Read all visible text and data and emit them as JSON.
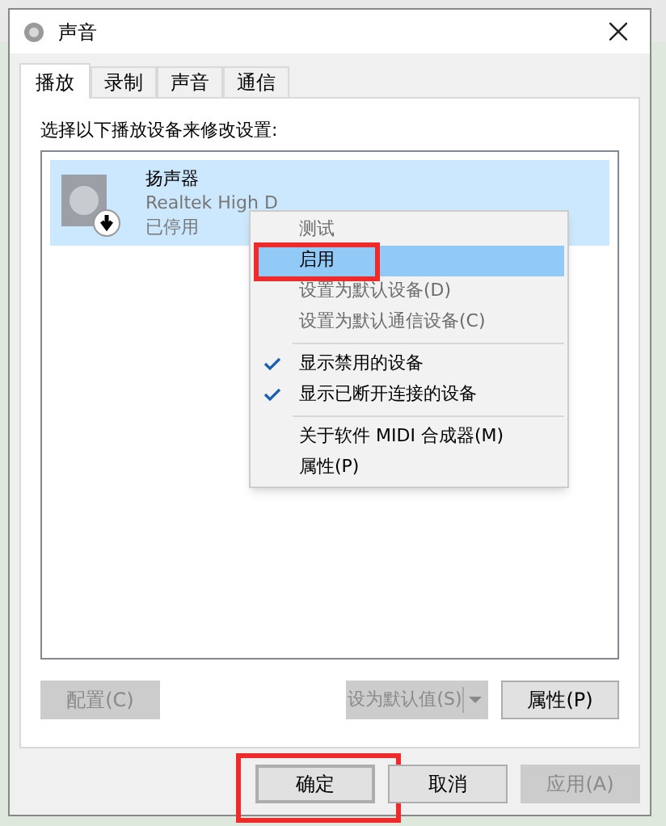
{
  "window": {
    "title": "声音"
  },
  "tabs": [
    {
      "label": "播放",
      "selected": true
    },
    {
      "label": "录制",
      "selected": false
    },
    {
      "label": "声音",
      "selected": false
    },
    {
      "label": "通信",
      "selected": false
    }
  ],
  "instruction": "选择以下播放设备来修改设置:",
  "devices": [
    {
      "name": "扬声器",
      "driver": "Realtek High D",
      "status": "已停用",
      "selected": true,
      "disabled": true
    }
  ],
  "context_menu": [
    {
      "kind": "item",
      "label": "测试",
      "disabled": true,
      "checked": false,
      "selected": false,
      "highlighted": false
    },
    {
      "kind": "item",
      "label": "启用",
      "disabled": false,
      "checked": false,
      "selected": true,
      "highlighted": true
    },
    {
      "kind": "item",
      "label": "设置为默认设备(D)",
      "disabled": true,
      "checked": false,
      "selected": false,
      "highlighted": false
    },
    {
      "kind": "item",
      "label": "设置为默认通信设备(C)",
      "disabled": true,
      "checked": false,
      "selected": false,
      "highlighted": false
    },
    {
      "kind": "separator"
    },
    {
      "kind": "item",
      "label": "显示禁用的设备",
      "disabled": false,
      "checked": true,
      "selected": false,
      "highlighted": false
    },
    {
      "kind": "item",
      "label": "显示已断开连接的设备",
      "disabled": false,
      "checked": true,
      "selected": false,
      "highlighted": false
    },
    {
      "kind": "separator"
    },
    {
      "kind": "item",
      "label": "关于软件 MIDI 合成器(M)",
      "disabled": false,
      "checked": false,
      "selected": false,
      "highlighted": false
    },
    {
      "kind": "item",
      "label": "属性(P)",
      "disabled": false,
      "checked": false,
      "selected": false,
      "highlighted": false
    }
  ],
  "panel_buttons": {
    "configure": {
      "label": "配置(C)",
      "disabled": true
    },
    "set_default": {
      "label": "设为默认值(S)",
      "disabled": true
    },
    "properties": {
      "label": "属性(P)",
      "disabled": false
    }
  },
  "dialog_buttons": [
    {
      "label": "确定",
      "disabled": false,
      "default": true,
      "highlighted": true
    },
    {
      "label": "取消",
      "disabled": false,
      "default": false,
      "highlighted": false
    },
    {
      "label": "应用(A)",
      "disabled": true,
      "default": false,
      "highlighted": false
    }
  ]
}
